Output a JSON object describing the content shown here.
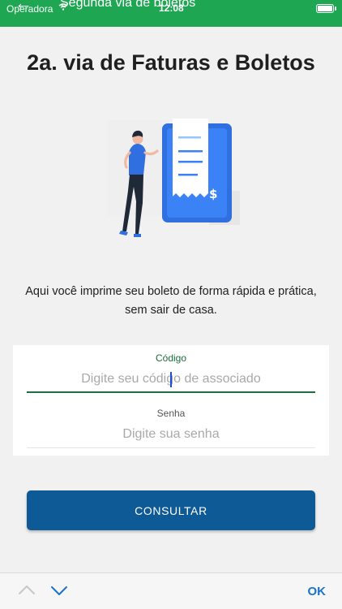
{
  "status_bar": {
    "carrier": "Operadora",
    "time": "12:08",
    "nav_title": "Segunda via de boletos"
  },
  "page": {
    "title": "2a. via de Faturas e Boletos",
    "description_line1": "Aqui você imprime seu boleto de forma rápida e prática,",
    "description_line2": "sem sair de casa."
  },
  "form": {
    "code_label": "Código",
    "code_placeholder": "Digite seu código de associado",
    "code_value": "",
    "password_label": "Senha",
    "password_placeholder": "Digite sua senha",
    "password_value": ""
  },
  "actions": {
    "submit_label": "CONSULTAR"
  },
  "keyboard_toolbar": {
    "done_label": "OK"
  },
  "colors": {
    "status_bar": "#1ea652",
    "button": "#0d5a96",
    "accent_green": "#1e6e3e",
    "illustration_blue": "#2f6fe0"
  },
  "icons": [
    "back-arrow-icon",
    "wifi-icon",
    "battery-icon",
    "chevron-up-icon",
    "chevron-down-icon",
    "invoice-illustration"
  ]
}
